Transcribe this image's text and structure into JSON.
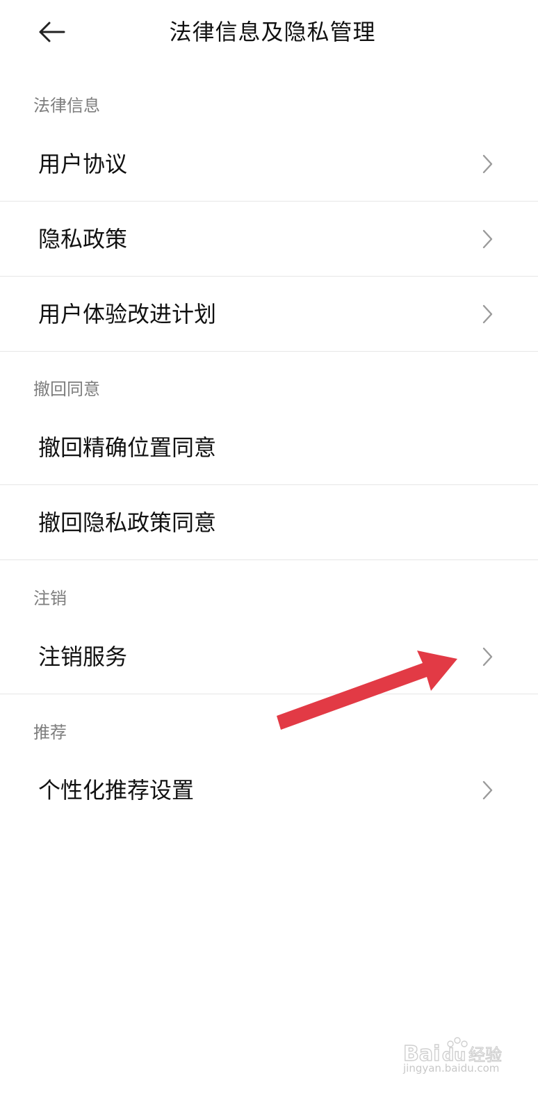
{
  "header": {
    "title": "法律信息及隐私管理",
    "back_icon": "back-arrow-icon"
  },
  "sections": [
    {
      "label": "法律信息",
      "items": [
        {
          "label": "用户协议",
          "has_chevron": true
        },
        {
          "label": "隐私政策",
          "has_chevron": true
        },
        {
          "label": "用户体验改进计划",
          "has_chevron": true
        }
      ]
    },
    {
      "label": "撤回同意",
      "items": [
        {
          "label": "撤回精确位置同意",
          "has_chevron": false
        },
        {
          "label": "撤回隐私政策同意",
          "has_chevron": false
        }
      ]
    },
    {
      "label": "注销",
      "items": [
        {
          "label": "注销服务",
          "has_chevron": true
        }
      ]
    },
    {
      "label": "推荐",
      "items": [
        {
          "label": "个性化推荐设置",
          "has_chevron": true
        }
      ]
    }
  ],
  "annotation": {
    "arrow_color": "#e23a45",
    "points_to": "注销服务"
  },
  "watermark": {
    "text": "Baidu经验",
    "url_text": "jingyan.baidu.com"
  },
  "colors": {
    "section_label": "#7d7d7d",
    "divider": "#e6e6e6",
    "chevron": "#9a9a9a"
  }
}
